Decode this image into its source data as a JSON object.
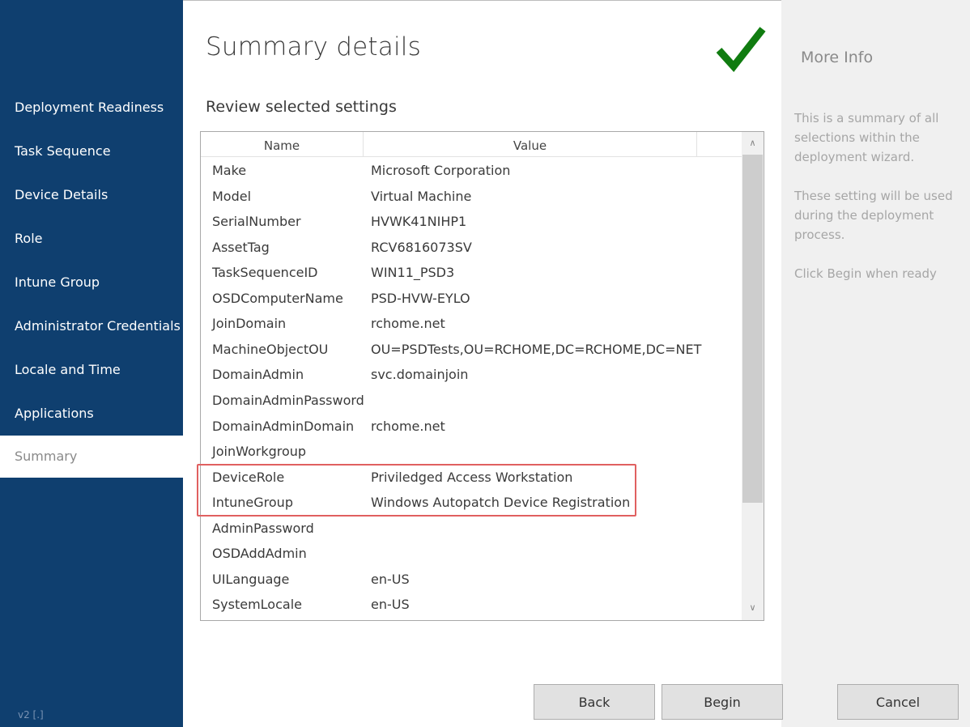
{
  "sidebar": {
    "items": [
      {
        "label": "Deployment Readiness",
        "active": false
      },
      {
        "label": "Task Sequence",
        "active": false
      },
      {
        "label": "Device Details",
        "active": false
      },
      {
        "label": "Role",
        "active": false
      },
      {
        "label": "Intune Group",
        "active": false
      },
      {
        "label": "Administrator Credentials",
        "active": false
      },
      {
        "label": "Locale and Time",
        "active": false
      },
      {
        "label": "Applications",
        "active": false
      },
      {
        "label": "Summary",
        "active": true
      }
    ],
    "version": "v2 [.]"
  },
  "main": {
    "title": "Summary details",
    "status_icon": "checkmark-icon",
    "status_color": "#107c10",
    "subtitle": "Review selected settings",
    "grid": {
      "columns": [
        "Name",
        "Value"
      ],
      "rows": [
        {
          "name": "Make",
          "value": "Microsoft Corporation"
        },
        {
          "name": "Model",
          "value": "Virtual Machine"
        },
        {
          "name": "SerialNumber",
          "value": "HVWK41NIHP1"
        },
        {
          "name": "AssetTag",
          "value": "RCV6816073SV"
        },
        {
          "name": "TaskSequenceID",
          "value": "WIN11_PSD3"
        },
        {
          "name": "OSDComputerName",
          "value": "PSD-HVW-EYLO"
        },
        {
          "name": "JoinDomain",
          "value": "rchome.net"
        },
        {
          "name": "MachineObjectOU",
          "value": "OU=PSDTests,OU=RCHOME,DC=RCHOME,DC=NET"
        },
        {
          "name": "DomainAdmin",
          "value": "svc.domainjoin"
        },
        {
          "name": "DomainAdminPassword",
          "value": ""
        },
        {
          "name": "DomainAdminDomain",
          "value": "rchome.net"
        },
        {
          "name": "JoinWorkgroup",
          "value": ""
        },
        {
          "name": "DeviceRole",
          "value": "Priviledged Access Workstation"
        },
        {
          "name": "IntuneGroup",
          "value": "Windows Autopatch Device Registration"
        },
        {
          "name": "AdminPassword",
          "value": ""
        },
        {
          "name": "OSDAddAdmin",
          "value": ""
        },
        {
          "name": "UILanguage",
          "value": "en-US"
        },
        {
          "name": "SystemLocale",
          "value": "en-US"
        }
      ],
      "scroll_up_icon": "chevron-up-icon",
      "scroll_down_icon": "chevron-down-icon"
    },
    "highlight_color": "#e06060"
  },
  "info": {
    "title": "More Info",
    "paragraphs": [
      "This is a summary of all selections within the deployment wizard.",
      "These setting will be used during the deployment process.",
      "Click Begin when ready"
    ]
  },
  "buttons": {
    "back": "Back",
    "begin": "Begin",
    "cancel": "Cancel"
  },
  "colors": {
    "sidebar_bg": "#0f3f6f",
    "info_bg": "#f0f0f0"
  }
}
